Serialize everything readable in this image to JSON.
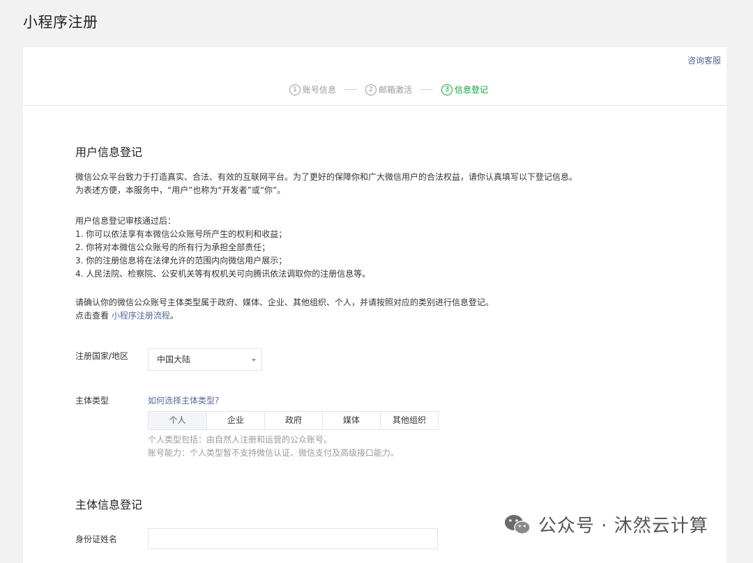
{
  "page": {
    "title": "小程序注册"
  },
  "header": {
    "consult_label": "咨询客服"
  },
  "steps": [
    {
      "num": "1",
      "label": "账号信息",
      "active": false
    },
    {
      "num": "2",
      "label": "邮箱激活",
      "active": false
    },
    {
      "num": "3",
      "label": "信息登记",
      "active": true
    }
  ],
  "user_info": {
    "title": "用户信息登记",
    "intro": [
      "微信公众平台致力于打造真实、合法、有效的互联网平台。为了更好的保障你和广大微信用户的合法权益，请你认真填写以下登记信息。",
      "为表述方便，本服务中，“用户”也称为“开发者”或“你”。"
    ],
    "after_review": [
      "用户信息登记审核通过后：",
      "1. 你可以依法享有本微信公众账号所产生的权利和收益；",
      "2. 你将对本微信公众账号的所有行为承担全部责任；",
      "3. 你的注册信息将在法律允许的范围内向微信用户展示；",
      "4. 人民法院、检察院、公安机关等有权机关可向腾讯依法调取你的注册信息等。"
    ],
    "confirm": "请确认你的微信公众账号主体类型属于政府、媒体、企业、其他组织、个人，并请按照对应的类别进行信息登记。",
    "view_prefix": "点击查看",
    "view_link": "小程序注册流程",
    "view_suffix": "。"
  },
  "form": {
    "region_label": "注册国家/地区",
    "region_value": "中国大陆",
    "subject_type_label": "主体类型",
    "subject_help_link": "如何选择主体类型?",
    "subject_types": [
      "个人",
      "企业",
      "政府",
      "媒体",
      "其他组织"
    ],
    "hint_1": "个人类型包括：由自然人注册和运营的公众账号。",
    "hint_2": "账号能力：个人类型暂不支持微信认证、微信支付及高级接口能力。"
  },
  "subject_info": {
    "title": "主体信息登记",
    "id_name_label": "身份证姓名",
    "id_name_value": ""
  },
  "watermark": {
    "text": "公众号 · 沐然云计算"
  },
  "colors": {
    "accent_green": "#07a53a",
    "link_blue": "#576b95",
    "hint_gray": "#9a9a9a"
  }
}
